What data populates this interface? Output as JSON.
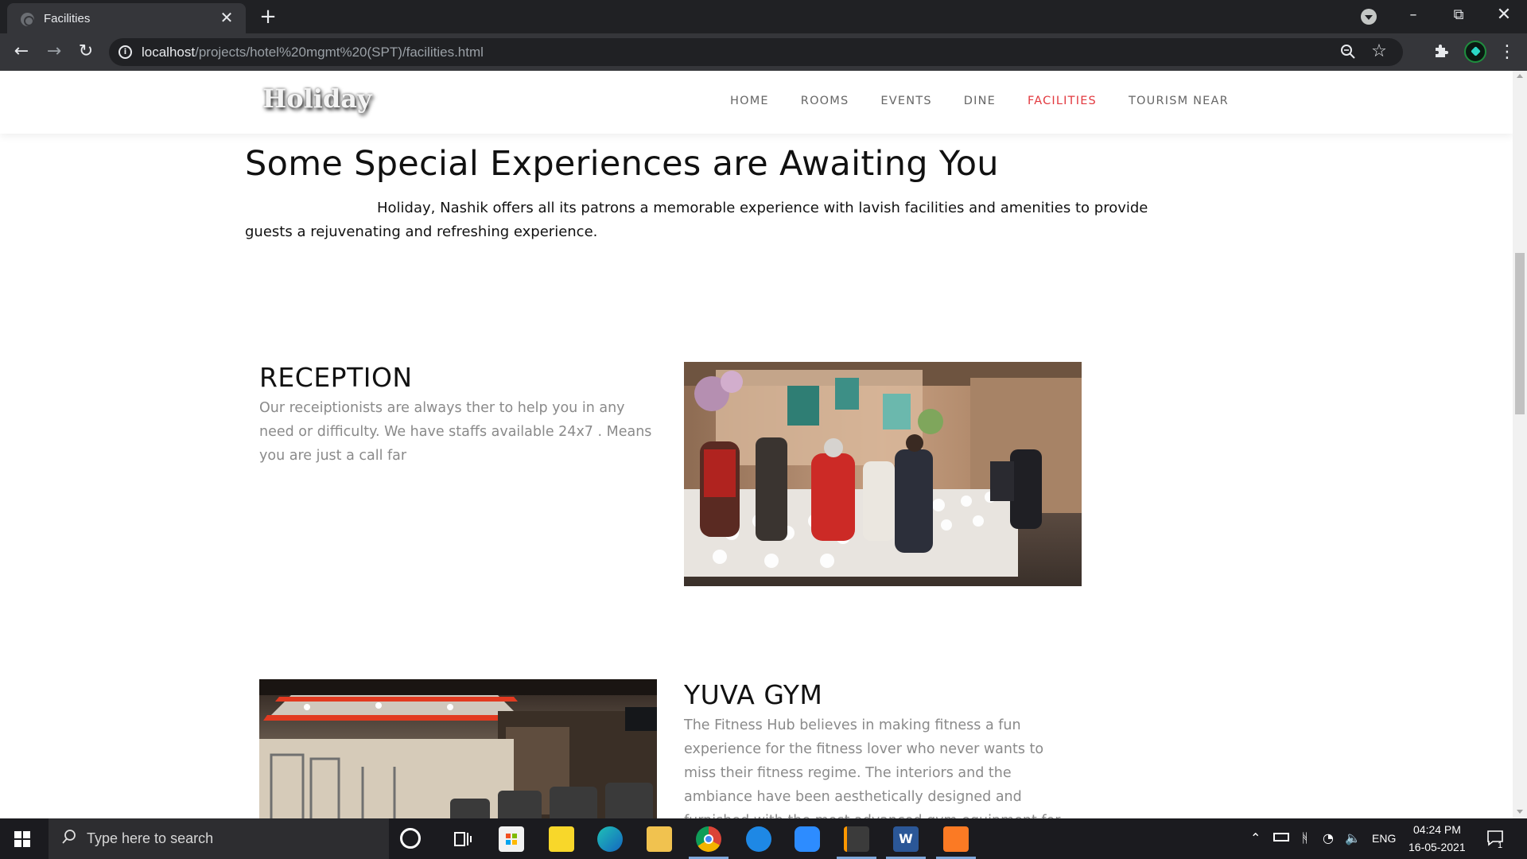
{
  "browser": {
    "tab_title": "Facilities",
    "tab_close": "✕",
    "new_tab": "+",
    "url_host": "localhost",
    "url_path": "/projects/hotel%20mgmt%20(SPT)/facilities.html"
  },
  "site": {
    "logo": "Holiday",
    "nav": [
      "HOME",
      "ROOMS",
      "EVENTS",
      "DINE",
      "FACILITIES",
      "TOURISM NEAR"
    ],
    "active_nav": "FACILITIES",
    "accent_color": "#e2393f"
  },
  "page": {
    "title": "Some Special Experiences are Awaiting You",
    "intro": "Holiday, Nashik offers all its patrons a memorable experience with lavish facilities and amenities to provide guests a rejuvenating and refreshing experience.",
    "facilities": [
      {
        "title": "RECEPTION",
        "text": "Our receiptionists are always ther to help you in any need or difficulty. We have staffs available 24x7 . Means you are just a call far"
      },
      {
        "title": "YUVA GYM",
        "text": "The Fitness Hub believes in making fitness a fun experience for the fitness lover who never wants to miss their fitness regime. The interiors and the ambiance have been aesthetically designed and furnished with the most advanced gym equipment for"
      }
    ]
  },
  "taskbar": {
    "search_placeholder": "Type here to search",
    "language": "ENG",
    "time": "04:24 PM",
    "date": "16-05-2021",
    "notification_count": "1"
  }
}
